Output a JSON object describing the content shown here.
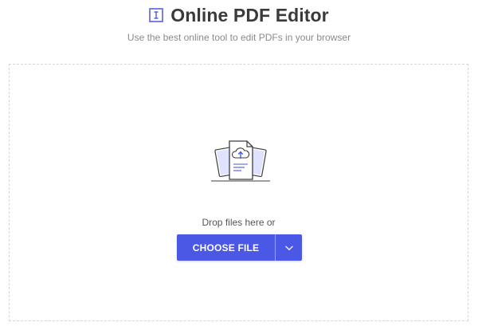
{
  "header": {
    "title": "Online PDF Editor",
    "title_icon": "text-cursor-box-icon",
    "subtitle": "Use the best online tool to edit PDFs in your browser"
  },
  "dropzone": {
    "illustration": "cloud-upload-document-icon",
    "prompt": "Drop files here or",
    "choose_button_label": "CHOOSE FILE",
    "dropdown_icon": "chevron-down-icon"
  },
  "colors": {
    "accent": "#4b57e5",
    "title_text": "#3a3a3a",
    "subtitle_text": "#8a8a8a",
    "border": "#d6d6d6"
  }
}
